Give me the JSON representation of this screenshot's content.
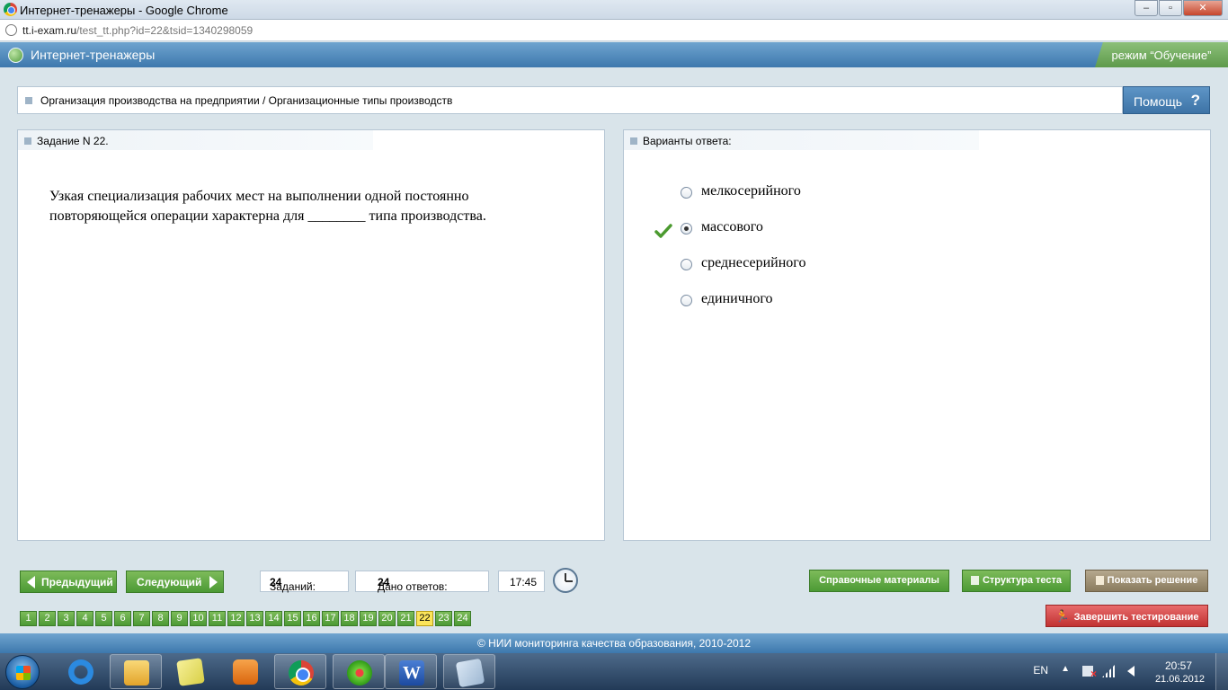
{
  "window": {
    "title": "Интернет-тренажеры - Google Chrome"
  },
  "address": {
    "domain": "tt.i-exam.ru",
    "path": "/test_tt.php?id=22&tsid=1340298059"
  },
  "header": {
    "app_title": "Интернет-тренажеры",
    "mode": "режим “Обучение”"
  },
  "breadcrumb": "Организация производства на предприятии / Организационные типы производств",
  "help": {
    "label": "Помощь",
    "icon": "?"
  },
  "task": {
    "heading": "Задание N 22.",
    "question_line1": "Узкая специализация рабочих мест на выполнении одной постоянно",
    "question_line2": "повторяющейся операции характерна для ________ типа производства."
  },
  "answers": {
    "heading": "Варианты ответа:",
    "options": [
      {
        "text": "мелкосерийного",
        "selected": false
      },
      {
        "text": "массового",
        "selected": true
      },
      {
        "text": "среднесерийного",
        "selected": false
      },
      {
        "text": "единичного",
        "selected": false
      }
    ]
  },
  "nav": {
    "prev": "Предыдущий",
    "next": "Следующий"
  },
  "stats": {
    "tasks_label": "Заданий:",
    "tasks_value": "24",
    "answers_label": "Дано ответов:",
    "answers_value": "24",
    "timer": "17:45"
  },
  "actions": {
    "reference": "Справочные материалы",
    "structure": "Структура теста",
    "solution": "Показать решение",
    "finish": "Завершить тестирование"
  },
  "pages": [
    "1",
    "2",
    "3",
    "4",
    "5",
    "6",
    "7",
    "8",
    "9",
    "10",
    "11",
    "12",
    "13",
    "14",
    "15",
    "16",
    "17",
    "18",
    "19",
    "20",
    "21",
    "22",
    "23",
    "24"
  ],
  "current_page": "22",
  "footer": "© НИИ мониторинга качества образования, 2010-2012",
  "taskbar": {
    "lang": "EN",
    "time": "20:57",
    "date": "21.06.2012"
  },
  "colors": {
    "accent_green": "#4c9a35",
    "header_blue": "#3d78ad",
    "finish_red": "#c13232",
    "active_page": "#fbe45a"
  }
}
